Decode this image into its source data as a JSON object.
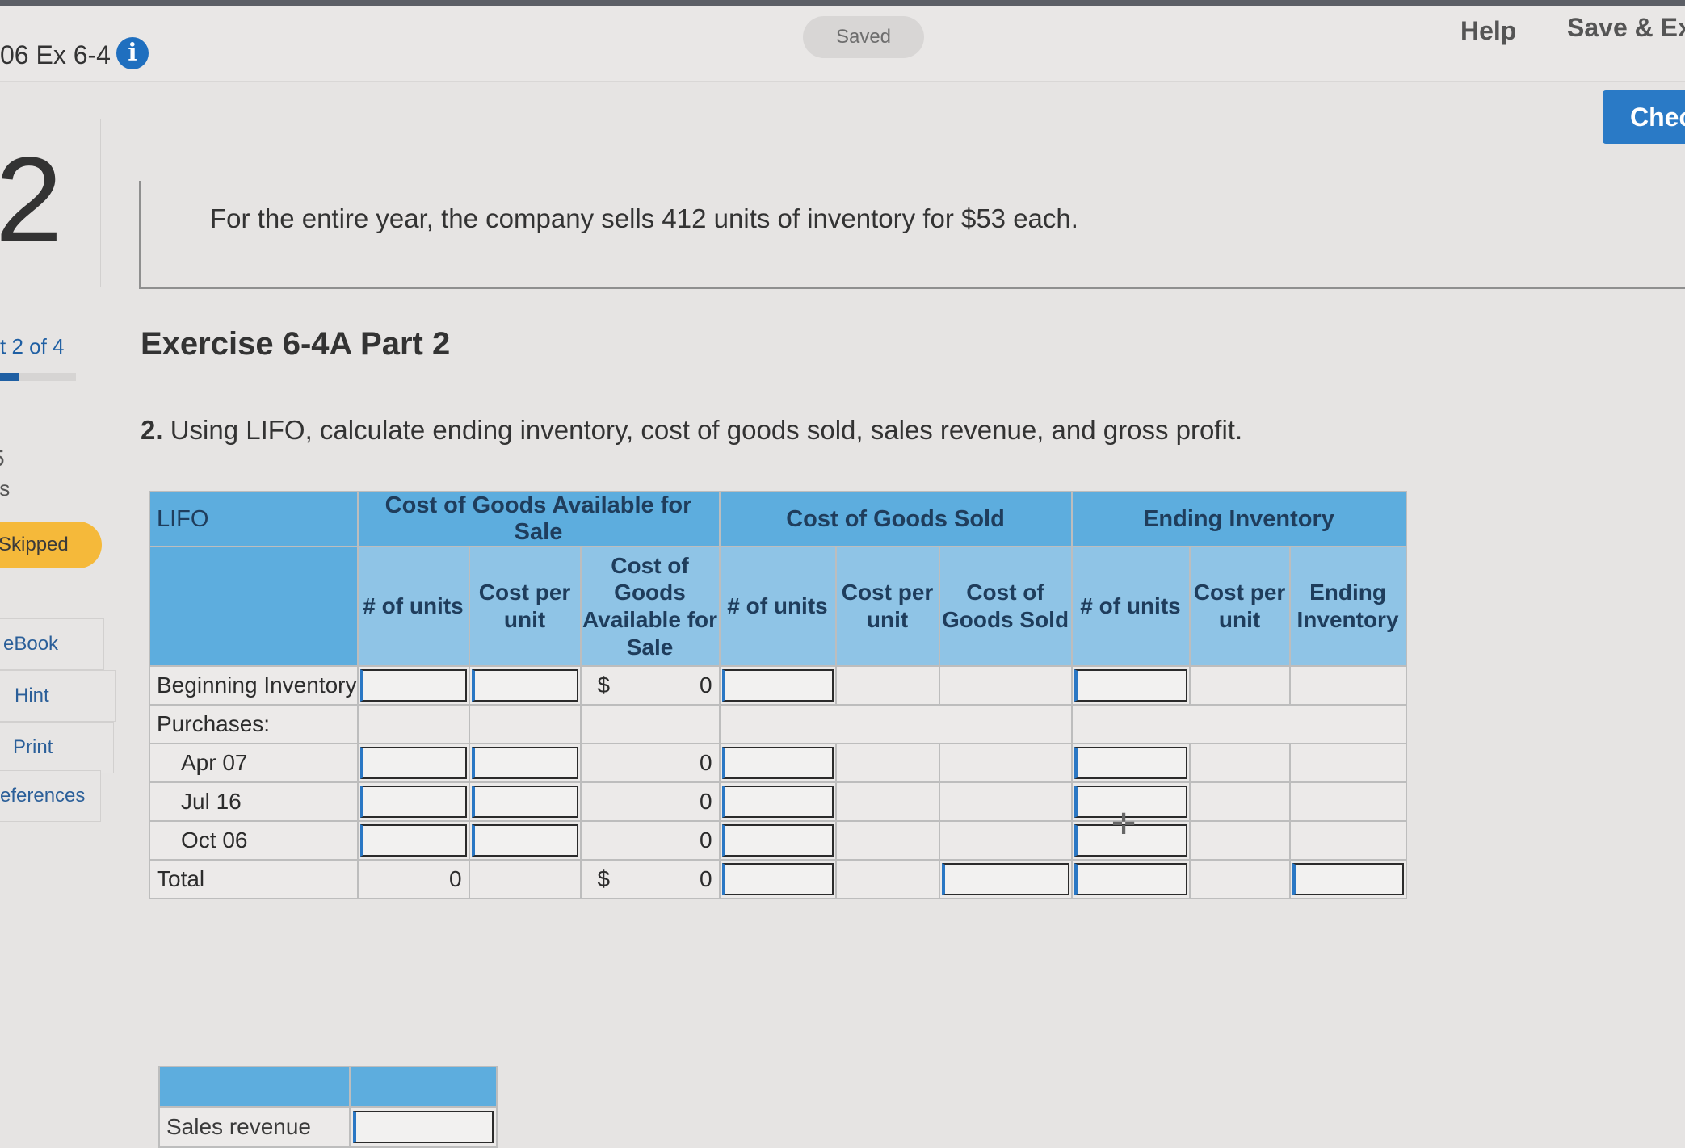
{
  "header": {
    "title": "06 Ex 6-4",
    "saved_label": "Saved",
    "help_label": "Help",
    "save_exit_label": "Save & Ex",
    "check_label": "Chec"
  },
  "sidebar": {
    "question_number": "2",
    "part_label": "t 2 of 4",
    "progress_fraction": 0.25,
    "points_number": "5",
    "points_label": "ts",
    "skipped_label": "Skipped",
    "buttons": [
      "eBook",
      "Hint",
      "Print",
      "eferences"
    ]
  },
  "main": {
    "intro": "For the entire year, the company sells 412 units of inventory for $53 each.",
    "part_title": "Exercise 6-4A Part 2",
    "question_number": "2.",
    "question_text": "Using LIFO, calculate ending inventory, cost of goods sold, sales revenue, and gross profit."
  },
  "table": {
    "corner_label": "LIFO",
    "group_headers": [
      "Cost of Goods Available for Sale",
      "Cost of Goods Sold",
      "Ending Inventory"
    ],
    "col_headers": [
      "# of units",
      "Cost per unit",
      "Cost of Goods Available for Sale",
      "# of units",
      "Cost per unit",
      "Cost of Goods Sold",
      "# of units",
      "Cost per unit",
      "Ending Inventory"
    ],
    "rows": [
      {
        "label": "Beginning Inventory",
        "dollar": "$",
        "available": "0"
      },
      {
        "label": "Purchases:"
      },
      {
        "label": "Apr 07",
        "available": "0"
      },
      {
        "label": "Jul 16",
        "available": "0"
      },
      {
        "label": "Oct 06",
        "available": "0"
      },
      {
        "label": "Total",
        "units": "0",
        "dollar": "$",
        "available": "0"
      }
    ]
  },
  "sales": {
    "label": "Sales revenue"
  }
}
